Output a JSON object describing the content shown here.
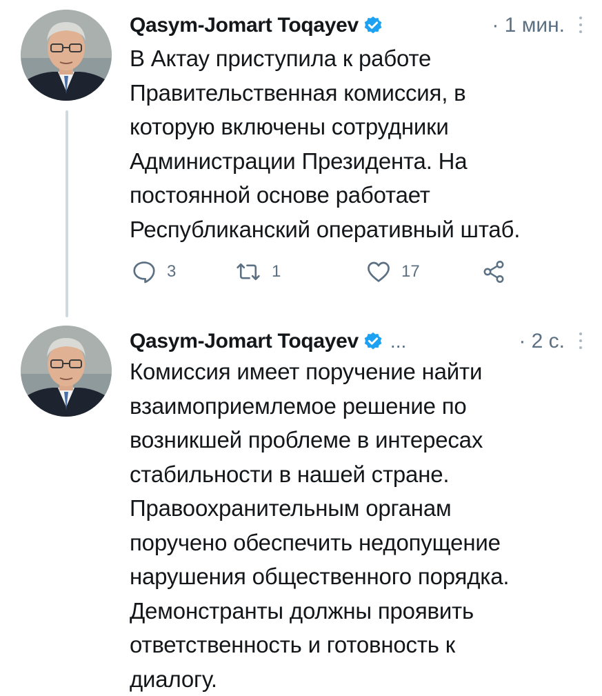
{
  "tweets": [
    {
      "author_name": "Qasym-Jomart Toqayev",
      "handle": "",
      "time": "· 1 мин.",
      "text_lines": [
        "В Актау приступила к работе",
        "Правительственная комиссия, в",
        "которую включены сотрудники",
        "Администрации Президента. На",
        "постоянной основе работает",
        "Республиканский оперативный штаб."
      ],
      "actions": {
        "reply_count": "3",
        "retweet_count": "1",
        "like_count": "17"
      }
    },
    {
      "author_name": "Qasym-Jomart Toqayev",
      "handle": "...",
      "time": "· 2 с.",
      "text_lines": [
        "Комиссия имеет поручение найти",
        "взаимоприемлемое решение по",
        "возникшей проблеме в интересах",
        "стабильности в нашей стране.",
        "Правоохранительным органам",
        "поручено обеспечить недопущение",
        "нарушения общественного порядка.",
        "Демонстранты должны проявить",
        "ответственность и готовность к",
        "диалогу."
      ]
    }
  ],
  "colors": {
    "verified": "#1da1f2",
    "secondary_text": "#5b7083",
    "primary_text": "#14171a",
    "thread_line": "#cfd9de"
  },
  "icons": [
    "verified-badge-icon",
    "more-options-icon",
    "reply-icon",
    "retweet-icon",
    "like-icon",
    "share-icon",
    "avatar-photo"
  ]
}
